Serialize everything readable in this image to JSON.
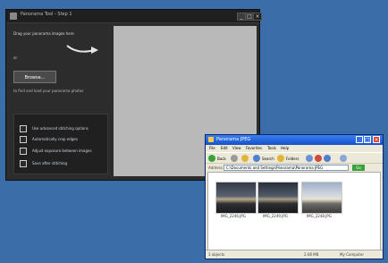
{
  "app": {
    "title": "Panorama Tool - Step 1",
    "minimize": "_",
    "maximize": "□",
    "close": "×",
    "drag_text": "Drag your panorama images here",
    "or_text": "or",
    "browse_label": "Browse...",
    "browse_hint": "to find and load your panorama photos",
    "options": [
      "Use advanced stitching options",
      "Automatically crop edges",
      "Adjust exposure between images",
      "Save after stitching"
    ]
  },
  "explorer": {
    "title": "Panorama JPEG",
    "minimize": "_",
    "maximize": "□",
    "close": "×",
    "menu": [
      "File",
      "Edit",
      "View",
      "Favorites",
      "Tools",
      "Help"
    ],
    "toolbar": {
      "back": "Back",
      "search": "Search",
      "folders": "Folders"
    },
    "address_label": "Address",
    "address_value": "C:\\Documents and Settings\\Panorama\\Panorama JPEG",
    "go_label": "Go",
    "files": [
      "IMG_2246.JPG",
      "IMG_2249.JPG",
      "IMG_2248.JPG"
    ],
    "status": {
      "text": "3 objects",
      "size": "2.08 MB",
      "zone": "My Computer"
    }
  },
  "colors": {
    "desktop": "#3b6ea8",
    "app_background": "#2c2c2c",
    "preview_pane": "#b9b9b9",
    "xp_title_blue": "#1651c9"
  }
}
